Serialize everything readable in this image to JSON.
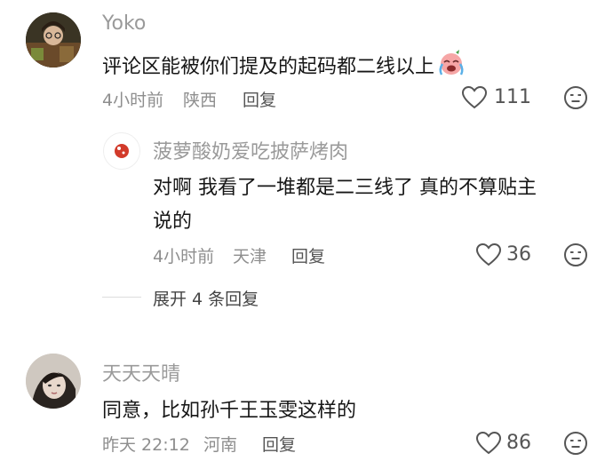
{
  "comments": [
    {
      "user": "Yoko",
      "text": "评论区能被你们提及的起码都二线以上",
      "emoji": "crying-laughing-emoji",
      "time": "4小时前",
      "location": "陕西",
      "reply_label": "回复",
      "likes": "111",
      "sub_comment": {
        "user": "菠萝酸奶爱吃披萨烤肉",
        "text_line1": "对啊 我看了一堆都是二三线了 真的不算贴主",
        "text_line2": "说的",
        "time": "4小时前",
        "location": "天津",
        "reply_label": "回复",
        "likes": "36"
      },
      "expand_label": "展开 4 条回复"
    },
    {
      "user": "天天天晴",
      "text": "同意，比如孙千王玉雯这样的",
      "time": "昨天 22:12",
      "location": "河南",
      "reply_label": "回复",
      "likes": "86"
    }
  ],
  "colors": {
    "name": "#9a9a9a",
    "meta": "#8e8e8e",
    "text": "#161616",
    "sub_avatar_red": "#d23a2a"
  },
  "icons": [
    "heart-outline-icon",
    "neutral-face-icon"
  ]
}
